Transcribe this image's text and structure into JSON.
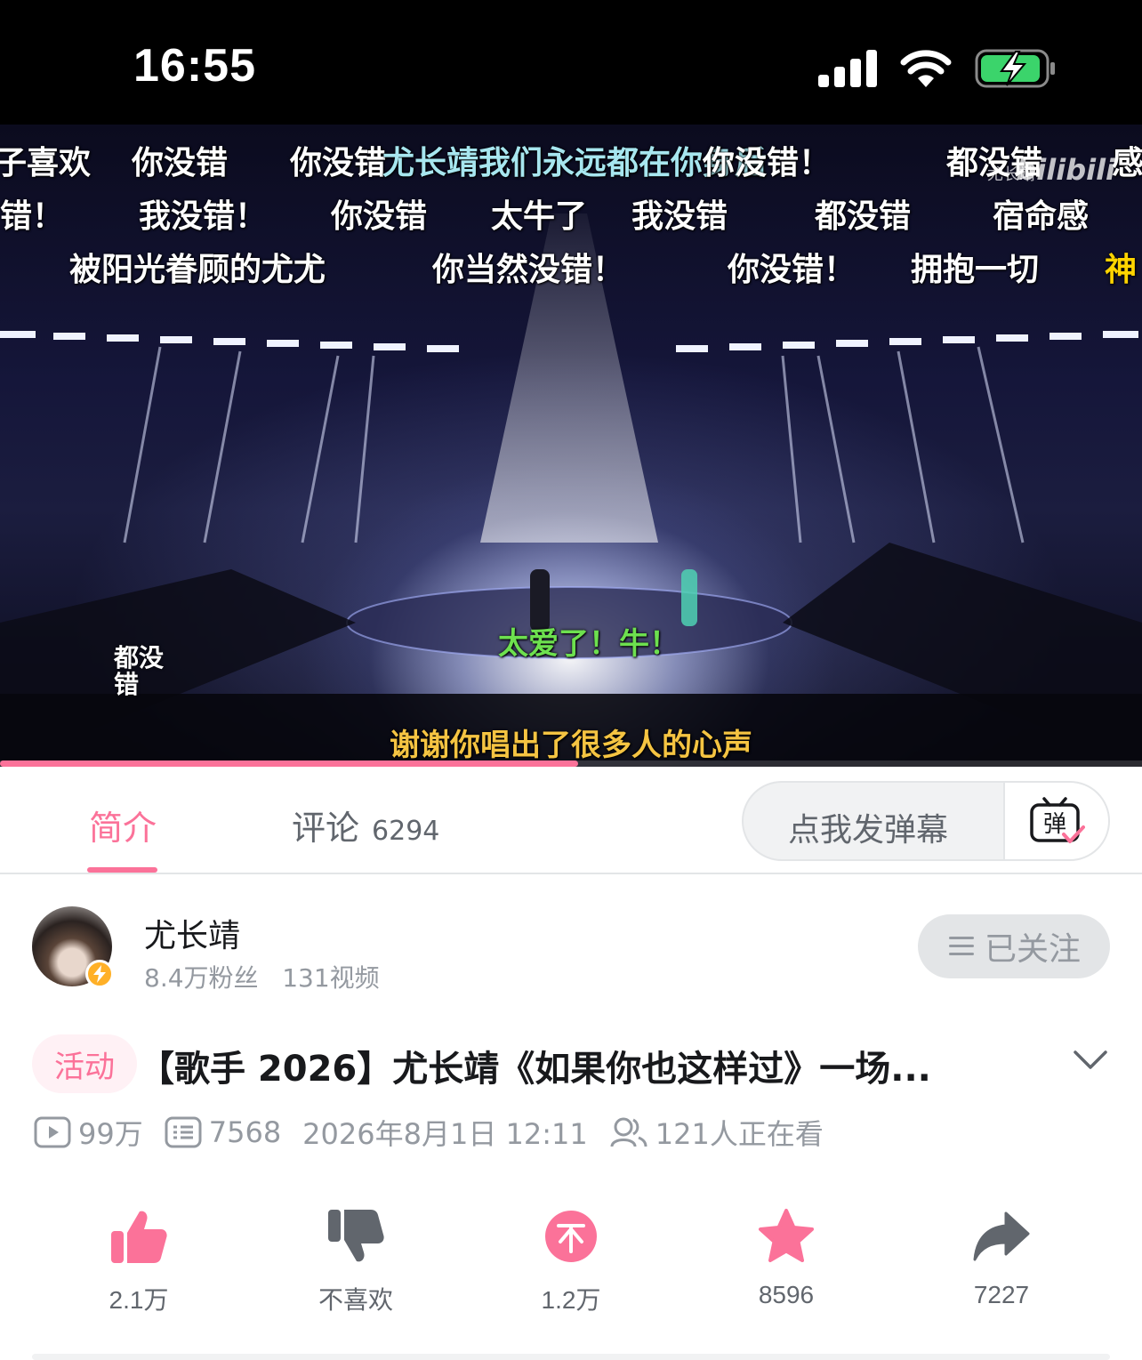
{
  "status_bar": {
    "time": "16:55"
  },
  "video": {
    "danmaku": [
      {
        "text": "子喜欢",
        "color": "white"
      },
      {
        "text": "你没错",
        "color": "white"
      },
      {
        "text": "你没错",
        "color": "white"
      },
      {
        "text": "尤长靖我们永远都在你身后",
        "color": "cyan"
      },
      {
        "text": "你没错！",
        "color": "white"
      },
      {
        "text": "都没错",
        "color": "white"
      },
      {
        "text": "感",
        "color": "white"
      },
      {
        "text": "错！",
        "color": "white"
      },
      {
        "text": "我没错！",
        "color": "white"
      },
      {
        "text": "你没错",
        "color": "white"
      },
      {
        "text": "太牛了",
        "color": "white"
      },
      {
        "text": "我没错",
        "color": "white"
      },
      {
        "text": "都没错",
        "color": "white"
      },
      {
        "text": "宿命感",
        "color": "white"
      },
      {
        "text": "被阳光眷顾的尤尤",
        "color": "white"
      },
      {
        "text": "你当然没错！",
        "color": "white"
      },
      {
        "text": "你没错！",
        "color": "white"
      },
      {
        "text": "拥抱一切",
        "color": "white"
      },
      {
        "text": "神",
        "color": "yellow"
      },
      {
        "text": "太爱了！牛！",
        "color": "green"
      }
    ],
    "vertical_danmaku": "都没错",
    "subtitle": "谢谢你唱出了很多人的心声",
    "watermark": "bilibili",
    "watermark_name": "尤长靖",
    "progress": 0.506
  },
  "tabs": {
    "intro": "简介",
    "comments": "评论",
    "comments_count": "6294",
    "danmaku_placeholder": "点我发弹幕",
    "danmaku_button_icon": "弹"
  },
  "uploader": {
    "name": "尤长靖",
    "fans": "8.4万粉丝",
    "videos": "131视频",
    "follow_label": "已关注"
  },
  "video_info": {
    "tag": "活动",
    "title": "【歌手 2026】尤长靖《如果你也这样过》一场...",
    "views": "99万",
    "danmaku_count": "7568",
    "date": "2026年8月1日 12:11",
    "watching": "121人正在看"
  },
  "actions": {
    "like": "2.1万",
    "dislike": "不喜欢",
    "coin": "1.2万",
    "favorite": "8596",
    "share": "7227"
  },
  "colors": {
    "accent": "#fb7299",
    "muted": "#9499a0"
  }
}
